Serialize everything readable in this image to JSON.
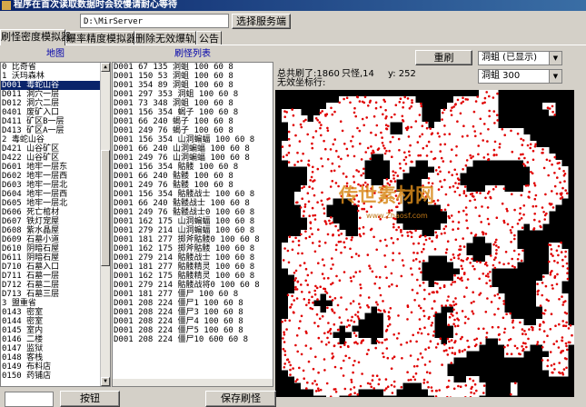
{
  "window": {
    "title": "程序在首次读取数据时会较慢请耐心等待"
  },
  "toolbar": {
    "server_path": "D:\\MirServer",
    "select_server_label": "选择服务端"
  },
  "tabs": [
    {
      "label": "刷怪密度模拟器",
      "active": true
    },
    {
      "label": "爆率精度模拟器",
      "active": false
    },
    {
      "label": "删除无效爆轨",
      "active": false
    },
    {
      "label": "公告",
      "active": false
    }
  ],
  "map_list": {
    "header": "地图",
    "items": [
      "0 比奇省",
      "1 沃玛森林",
      "D001 毒蛇山谷",
      "D011 洞穴一层",
      "D012 洞穴二层",
      "0401 废矿入口",
      "D411 矿区B一层",
      "D413 矿区A一层",
      "2 毒蛇山谷",
      "D421 山谷矿区",
      "D422 山谷矿区",
      "D601 地牢一层东",
      "D602 地牢一层西",
      "D603 地牢一层北",
      "D604 地牢一层西",
      "D605 地牢一层北",
      "D606 死亡棺材",
      "D607 铁灯宠屋",
      "D608 紫水晶屋",
      "D609 石墓小道",
      "D610 阴暗石屋",
      "D611 阴暗石屋",
      "D710 石墓入口",
      "D711 石墓一层",
      "D712 石墓二层",
      "D713 石墓三层",
      "3 盟重省",
      "0143 密室",
      "0144 密室",
      "0145 室内",
      "0146 二楼",
      "0147 监狱",
      "0148 客栈",
      "0149 布料店",
      "0150 药铺店"
    ],
    "selected_index": 2
  },
  "spawn_list": {
    "header": "刷怪列表",
    "rows": [
      "D001 67 135 洞蛆 100 60 8",
      "D001 150 53 洞蛆 100 60 8",
      "D001 354 89 洞蛆 100 60 8",
      "D001 297 353 洞蛆 100 60 8",
      "D001 73 348 洞蛆 100 60 8",
      "D001 156 354 蝎子 100 60 8",
      "D001 66 240 蝎子 100 60 8",
      "D001 249 76 蝎子 100 60 8",
      "D001 156 354 山洞蝙蝠 100 60 8",
      "D001 66 240 山洞蝙蝠 100 60 8",
      "D001 249 76 山洞蝙蝠 100 60 8",
      "D001 156 354 骷髅 100 60 8",
      "D001 66 240 骷髅 100 60 8",
      "D001 249 76 骷髅 100 60 8",
      "D001 156 354 骷髅战士 100 60 8",
      "D001 66 240 骷髅战士 100 60 8",
      "D001 249 76 骷髅战士0 100 60 8",
      "D001 162 175 山洞蝙蝠 100 60 8",
      "D001 279 214 山洞蝙蝠 100 60 8",
      "D001 181 277 掷斧骷髅0 100 60 8",
      "D001 162 175 掷斧骷髅 100 60 8",
      "D001 279 214 骷髅战士 100 60 8",
      "D001 181 277 骷髅精灵 100 60 8",
      "D001 162 175 骷髅精灵 100 60 8",
      "D001 279 214 骷髅战将0 100 60 8",
      "D001 181 277 僵尸 100 60 8",
      "D001 208 224 僵尸1 100 60 8",
      "D001 208 224 僵尸3 100 60 8",
      "D001 208 224 僵尸4 100 60 8",
      "D001 208 224 僵尸5 100 60 8",
      "D001 208 224 僵尸10 600 60 8"
    ]
  },
  "stats": {
    "total_label": "总共刷了:1860",
    "count_label": "只怪,14",
    "y_label": "y: 252",
    "coord_label": "无效坐标行:"
  },
  "controls": {
    "refresh_label": "重刷",
    "display_select": "洞蛆 (已显示)",
    "monster_select": "洞蛆 300"
  },
  "bottom": {
    "button_label": "按钮",
    "save_label": "保存刷怪"
  },
  "watermark": {
    "text": "传世素材网",
    "sub": "www.Zhaosf.com"
  },
  "colors": {
    "selection": "#0a246a",
    "header_text": "#0000aa",
    "spawn_dot": "#e00000",
    "map_floor": "#ffffff",
    "map_wall": "#000000"
  }
}
